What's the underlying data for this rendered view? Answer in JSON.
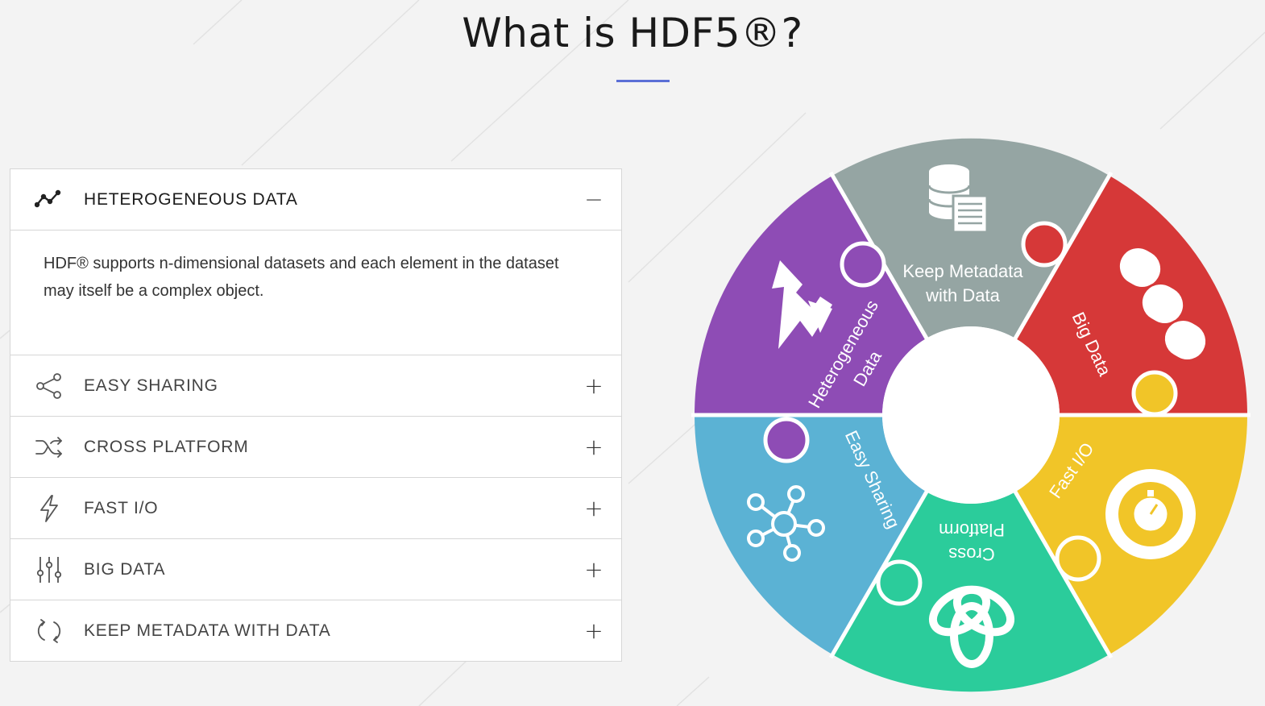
{
  "page": {
    "title": "What is HDF5®?"
  },
  "accordion": {
    "items": [
      {
        "label": "HETEROGENEOUS DATA",
        "icon": "line-chart-icon",
        "state": "open",
        "toggle": "−",
        "body": "HDF® supports n-dimensional datasets and each element in the dataset may itself be a complex object."
      },
      {
        "label": "EASY SHARING",
        "icon": "share-icon",
        "state": "collapsed",
        "toggle": "+"
      },
      {
        "label": "CROSS PLATFORM",
        "icon": "shuffle-icon",
        "state": "collapsed",
        "toggle": "+"
      },
      {
        "label": "FAST I/O",
        "icon": "lightning-icon",
        "state": "collapsed",
        "toggle": "+"
      },
      {
        "label": "BIG DATA",
        "icon": "sliders-icon",
        "state": "collapsed",
        "toggle": "+"
      },
      {
        "label": "KEEP METADATA WITH DATA",
        "icon": "refresh-icon",
        "state": "collapsed",
        "toggle": "+"
      }
    ]
  },
  "wheel": {
    "segments": [
      {
        "label1": "Keep Metadata",
        "label2": "with Data",
        "color": "#95a5a3",
        "icon": "database-document-icon"
      },
      {
        "label1": "Big Data",
        "label2": "",
        "color": "#d63838",
        "icon": "disk-stack-icon"
      },
      {
        "label1": "Fast I/O",
        "label2": "",
        "color": "#f1c528",
        "icon": "stopwatch-cycle-icon"
      },
      {
        "label1": "Cross",
        "label2": "Platform",
        "color": "#2bcc9b",
        "icon": "triquetra-icon"
      },
      {
        "label1": "Easy Sharing",
        "label2": "",
        "color": "#5bb2d4",
        "icon": "network-icon"
      },
      {
        "label1": "Heterogeneous",
        "label2": "Data",
        "color": "#8e4cb5",
        "icon": "mixed-shapes-icon"
      }
    ]
  },
  "colors": {
    "accent": "#5b6fd6",
    "background": "#f3f3f3"
  }
}
